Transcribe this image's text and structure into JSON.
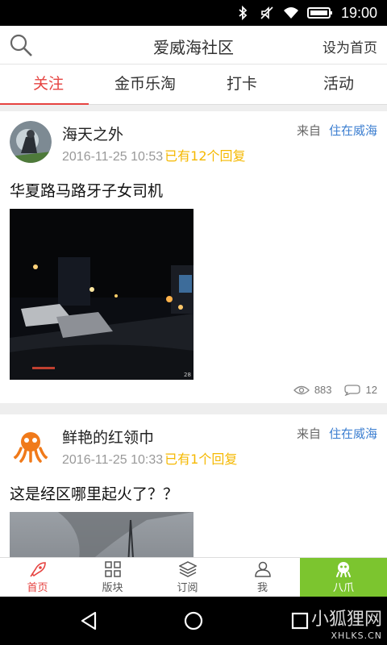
{
  "status_bar": {
    "time": "19:00"
  },
  "header": {
    "title": "爱威海社区",
    "set_home": "设为首页"
  },
  "tabs": [
    {
      "label": "关注",
      "active": true
    },
    {
      "label": "金币乐淘",
      "active": false
    },
    {
      "label": "打卡",
      "active": false
    },
    {
      "label": "活动",
      "active": false
    }
  ],
  "posts": [
    {
      "author": "海天之外",
      "timestamp": "2016-11-25 10:53",
      "replies": "已有12个回复",
      "from_label": "来自",
      "forum": "住在威海",
      "title": "华夏路马路牙子女司机",
      "views": "883",
      "comments": "12"
    },
    {
      "author": "鲜艳的红领巾",
      "timestamp": "2016-11-25 10:33",
      "replies": "已有1个回复",
      "from_label": "来自",
      "forum": "住在威海",
      "title": "这是经区哪里起火了？？"
    }
  ],
  "bottom_nav": [
    {
      "label": "首页",
      "icon": "rocket-icon",
      "active": true
    },
    {
      "label": "版块",
      "icon": "grid-icon",
      "active": false
    },
    {
      "label": "订阅",
      "icon": "layers-icon",
      "active": false
    },
    {
      "label": "我",
      "icon": "person-icon",
      "active": false
    },
    {
      "label": "八爪",
      "icon": "octopus-icon",
      "active": false
    }
  ],
  "watermark": {
    "main": "小狐狸网",
    "sub": "XHLKS.CN"
  },
  "colors": {
    "accent": "#e64340",
    "reply": "#f5b800",
    "link": "#3b7ed0",
    "special_tab": "#7cc52f"
  }
}
